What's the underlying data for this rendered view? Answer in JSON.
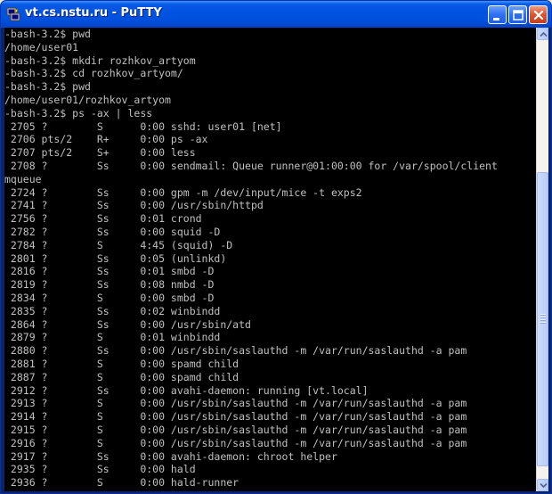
{
  "window": {
    "title": "vt.cs.nstu.ru - PuTTY",
    "icon": "putty-icon",
    "buttons": {
      "minimize": "minimize-icon",
      "maximize": "maximize-icon",
      "close": "close-icon"
    }
  },
  "terminal": {
    "lines": [
      "-bash-3.2$ pwd",
      "/home/user01",
      "-bash-3.2$ mkdir rozhkov_artyom",
      "-bash-3.2$ cd rozhkov_artyom/",
      "-bash-3.2$ pwd",
      "/home/user01/rozhkov_artyom",
      "-bash-3.2$ ps -ax | less",
      " 2705 ?        S      0:00 sshd: user01 [net]",
      " 2706 pts/2    R+     0:00 ps -ax",
      " 2707 pts/2    S+     0:00 less",
      " 2708 ?        Ss     0:00 sendmail: Queue runner@01:00:00 for /var/spool/client",
      "mqueue",
      " 2724 ?        Ss     0:00 gpm -m /dev/input/mice -t exps2",
      " 2741 ?        Ss     0:00 /usr/sbin/httpd",
      " 2756 ?        Ss     0:01 crond",
      " 2782 ?        Ss     0:00 squid -D",
      " 2784 ?        S      4:45 (squid) -D",
      " 2801 ?        Ss     0:05 (unlinkd)",
      " 2816 ?        Ss     0:01 smbd -D",
      " 2819 ?        Ss     0:08 nmbd -D",
      " 2834 ?        S      0:00 smbd -D",
      " 2835 ?        Ss     0:02 winbindd",
      " 2864 ?        Ss     0:00 /usr/sbin/atd",
      " 2879 ?        S      0:01 winbindd",
      " 2880 ?        Ss     0:00 /usr/sbin/saslauthd -m /var/run/saslauthd -a pam",
      " 2881 ?        S      0:00 spamd child",
      " 2887 ?        S      0:00 spamd child",
      " 2912 ?        Ss     0:00 avahi-daemon: running [vt.local]",
      " 2913 ?        S      0:00 /usr/sbin/saslauthd -m /var/run/saslauthd -a pam",
      " 2914 ?        S      0:00 /usr/sbin/saslauthd -m /var/run/saslauthd -a pam",
      " 2915 ?        S      0:00 /usr/sbin/saslauthd -m /var/run/saslauthd -a pam",
      " 2916 ?        S      0:00 /usr/sbin/saslauthd -m /var/run/saslauthd -a pam",
      " 2917 ?        Ss     0:00 avahi-daemon: chroot helper",
      " 2935 ?        Ss     0:00 hald",
      " 2936 ?        S      0:00 hald-runner"
    ]
  },
  "scrollbar": {
    "up": "scroll-up-arrow-icon",
    "down": "scroll-down-arrow-icon"
  },
  "colors": {
    "terminal_bg": "#000000",
    "terminal_fg": "#c0c0c0",
    "titlebar": "#0053e0"
  }
}
